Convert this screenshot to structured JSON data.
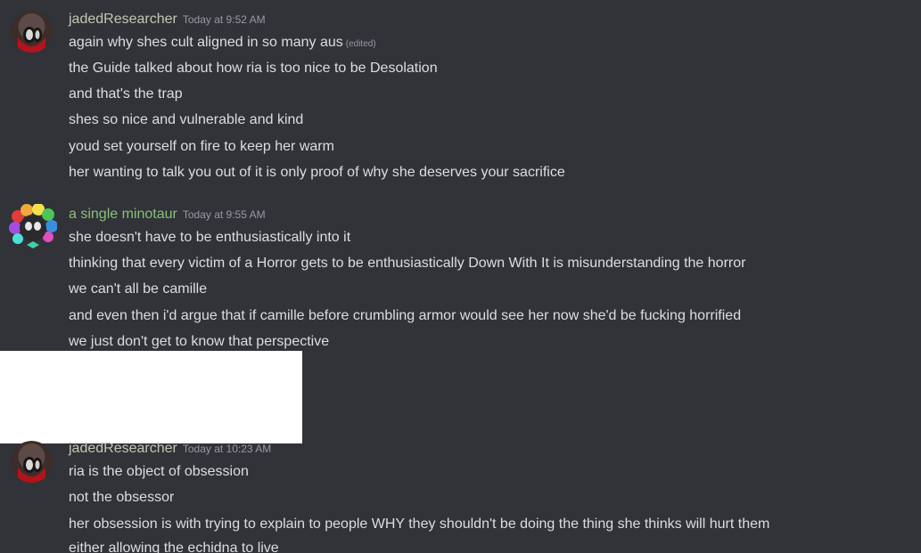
{
  "messages": [
    {
      "username": "jadedResearcher",
      "timestamp": "Today at 9:52 AM",
      "edited_label": "(edited)",
      "lines": [
        "again why shes cult aligned in so many aus",
        "the Guide talked about how ria is too nice to be Desolation",
        "and that's the trap",
        "shes so nice and vulnerable and kind",
        "youd set yourself on fire to keep her warm",
        "her wanting to talk you out of it is only proof of why she deserves your sacrifice"
      ]
    },
    {
      "username": "a single minotaur",
      "timestamp": "Today at 9:55 AM",
      "lines": [
        "she doesn't have to be enthusiastically into it",
        "thinking that every victim of a Horror gets to be enthusiastically Down With It is misunderstanding the horror",
        "we can't all be camille",
        "and even then i'd argue that if camille before crumbling armor would see her now she'd be fucking horrified",
        "we just don't get to know that perspective"
      ]
    },
    {
      "username": "jadedResearcher",
      "timestamp": "Today at 10:23 AM",
      "lines": [
        "ria is the object of obsession",
        "not the obsessor",
        "her obsession is with trying to explain to people WHY they shouldn't be doing the thing she thinks will hurt them",
        "either allowing the echidna to live"
      ]
    }
  ]
}
